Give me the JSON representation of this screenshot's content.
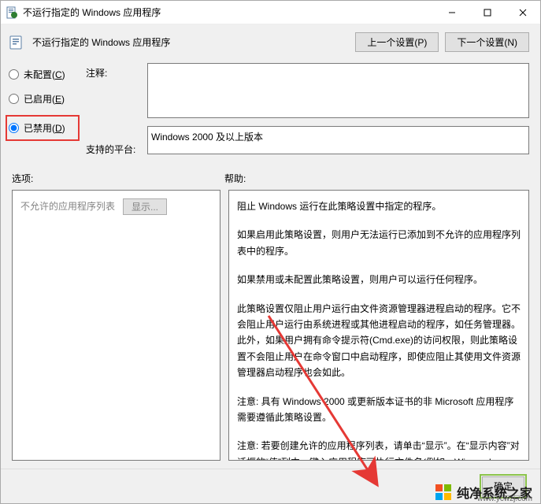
{
  "window": {
    "title": "不运行指定的 Windows 应用程序"
  },
  "header": {
    "title": "不运行指定的 Windows 应用程序",
    "prev_btn": "上一个设置(P)",
    "next_btn": "下一个设置(N)"
  },
  "radios": {
    "not_configured": "未配置(C)",
    "enabled": "已启用(E)",
    "disabled": "已禁用(D)",
    "selected": "disabled"
  },
  "labels": {
    "comment": "注释:",
    "platform": "支持的平台:",
    "options": "选项:",
    "help": "帮助:"
  },
  "fields": {
    "comment_value": "",
    "platform_value": "Windows 2000 及以上版本"
  },
  "options_pane": {
    "list_label": "不允许的应用程序列表",
    "show_btn": "显示..."
  },
  "help_text": {
    "p1": "阻止 Windows 运行在此策略设置中指定的程序。",
    "p2": "如果启用此策略设置，则用户无法运行已添加到不允许的应用程序列表中的程序。",
    "p3": "如果禁用或未配置此策略设置，则用户可以运行任何程序。",
    "p4": "此策略设置仅阻止用户运行由文件资源管理器进程启动的程序。它不会阻止用户运行由系统进程或其他进程启动的程序，如任务管理器。此外，如果用户拥有命令提示符(Cmd.exe)的访问权限，则此策略设置不会阻止用户在命令窗口中启动程序，即使应阻止其使用文件资源管理器启动程序也会如此。",
    "p5": "注意: 具有 Windows 2000 或更新版本证书的非 Microsoft 应用程序需要遵循此策略设置。",
    "p6": "注意: 若要创建允许的应用程序列表，请单击“显示”。在“显示内容”对话框的“值”列中，键入应用程序可执行文件名(例如，Winword.exe、Poledit.exe 和 Powerpnt.exe)。"
  },
  "footer": {
    "ok": "确定"
  },
  "watermark": {
    "brand": "纯净系统之家",
    "url": "www.ycwzj.com"
  }
}
